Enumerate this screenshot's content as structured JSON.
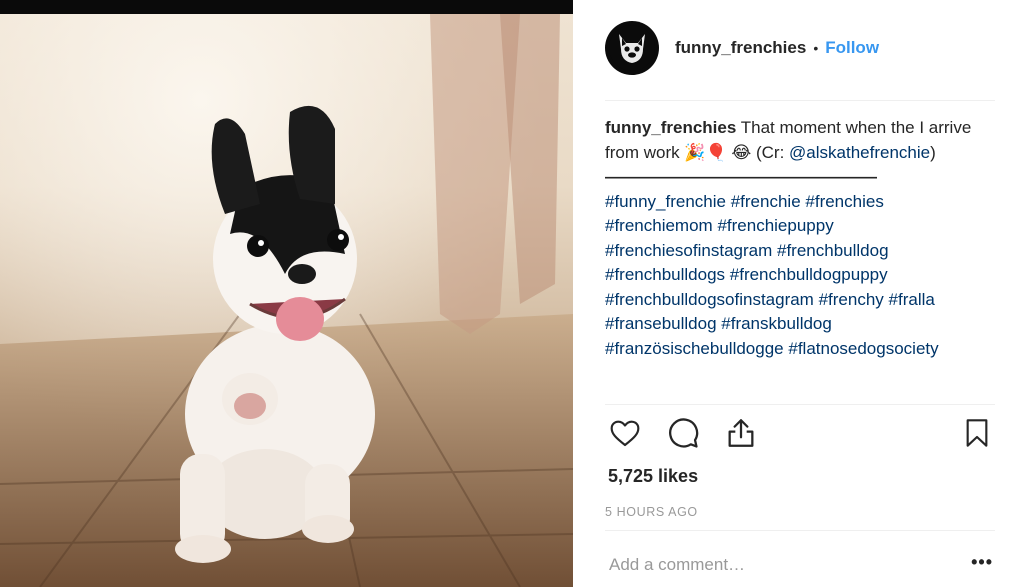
{
  "post": {
    "username": "funny_frenchies",
    "follow_label": "Follow",
    "separator": "•",
    "caption_text": "That moment when the I arrive from work 🎉🎈 😂 (Cr:",
    "mention": "@alskathefrenchie",
    "closing_paren": ")",
    "dashes": "————————————————",
    "hashtags": [
      "#funny_frenchie",
      "#frenchie",
      "#frenchies",
      "#frenchiemom",
      "#frenchiepuppy",
      "#frenchiesofinstagram",
      "#frenchbulldog",
      "#frenchbulldogs",
      "#frenchbulldogpuppy",
      "#frenchbulldogsofinstagram",
      "#frenchy",
      "#fralla",
      "#fransebulldog",
      "#franskbulldog",
      "#französischebulldogge",
      "#flatnosedogsociety"
    ],
    "likes": "5,725 likes",
    "time_ago": "5 HOURS AGO",
    "comment_placeholder": "Add a comment…",
    "more_label": "•••"
  },
  "icons": {
    "like": "heart-icon",
    "comment": "comment-icon",
    "share": "share-icon",
    "save": "bookmark-icon",
    "avatar": "bulldog-avatar"
  }
}
